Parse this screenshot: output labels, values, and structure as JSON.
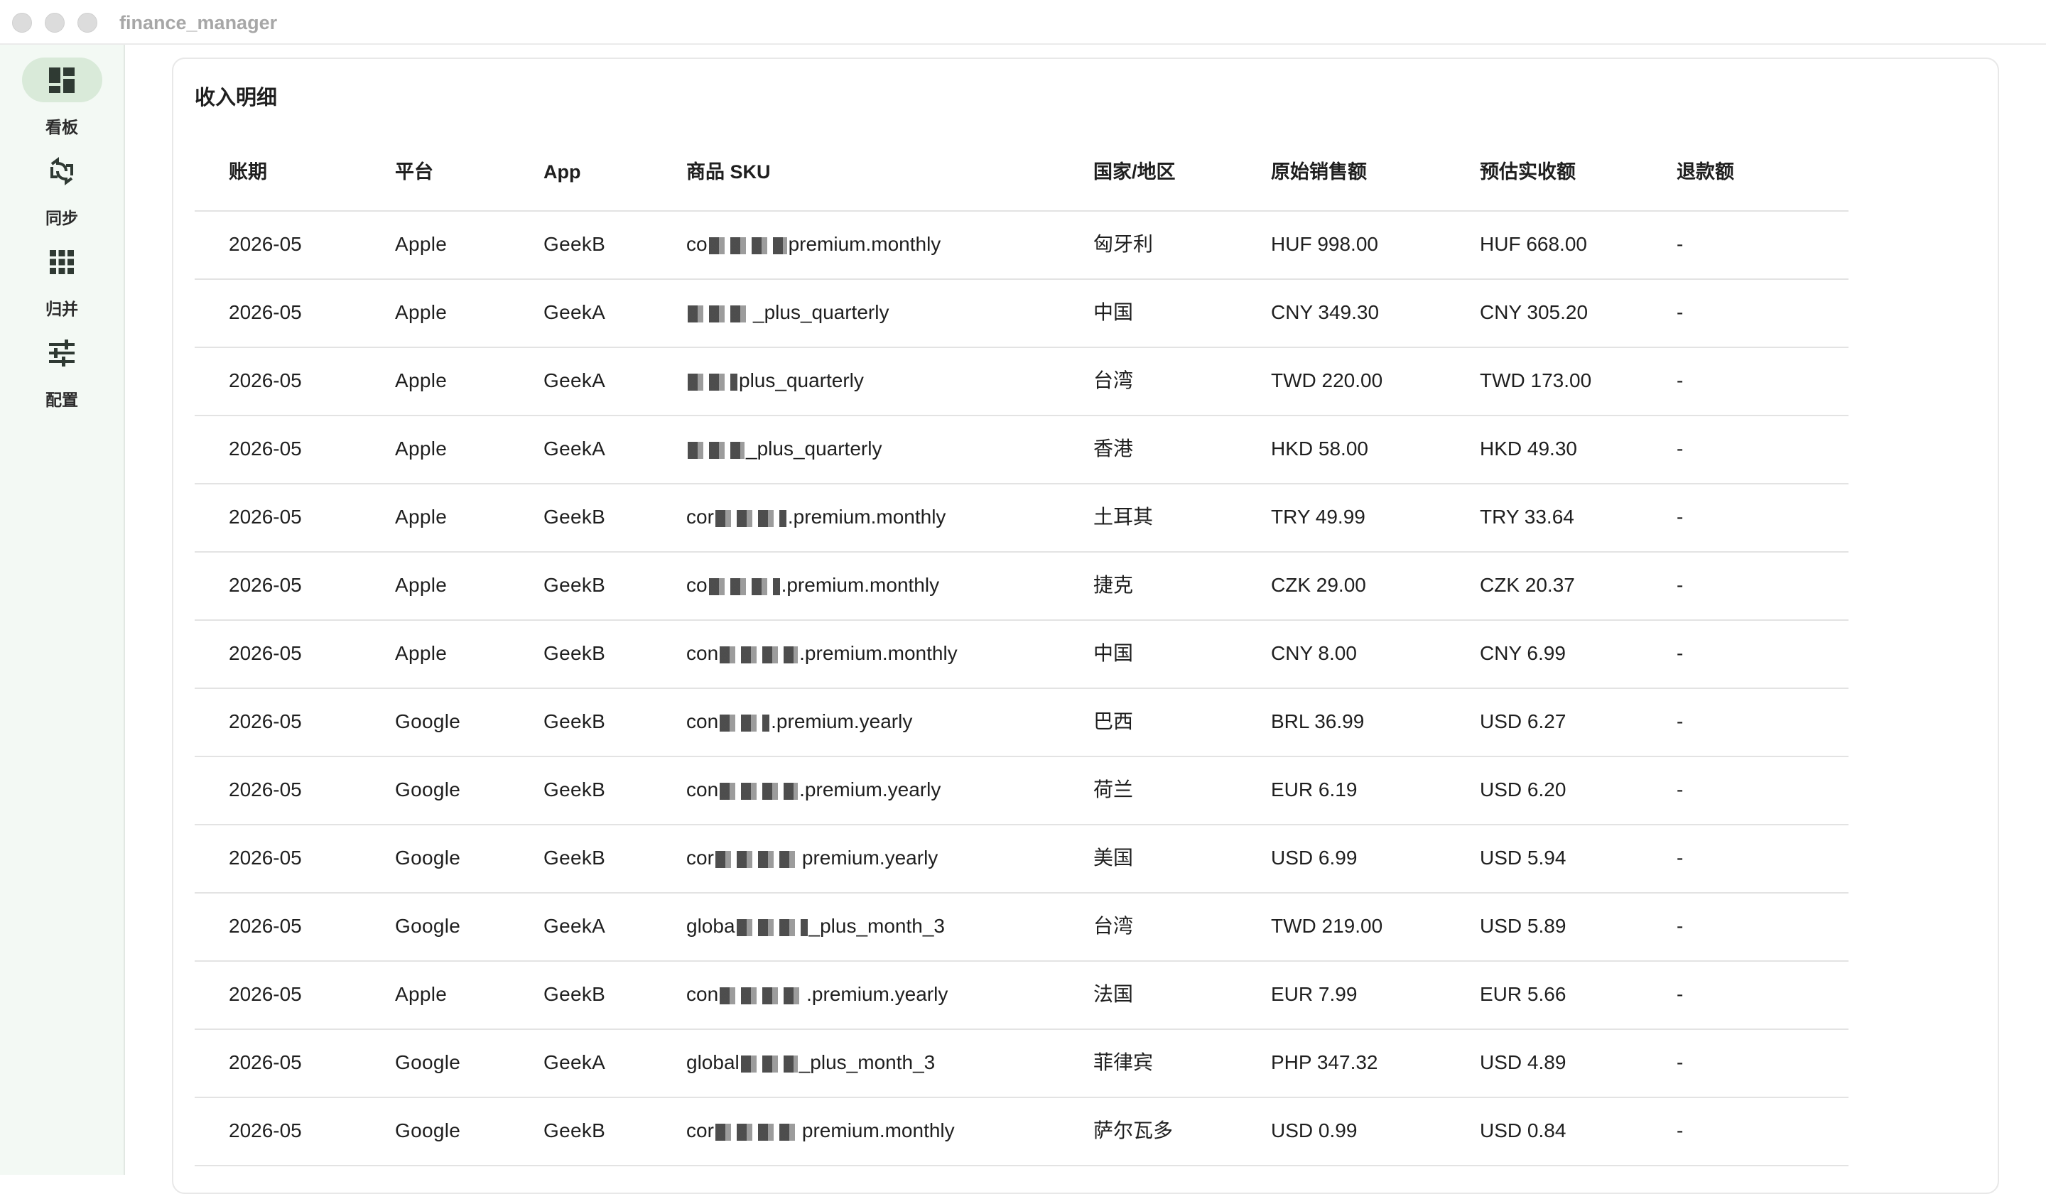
{
  "window": {
    "title": "finance_manager"
  },
  "sidebar": {
    "items": [
      {
        "label": "看板",
        "icon": "dashboard-icon",
        "active": true
      },
      {
        "label": "同步",
        "icon": "sync-icon",
        "active": false
      },
      {
        "label": "归并",
        "icon": "grid-icon",
        "active": false
      },
      {
        "label": "配置",
        "icon": "sliders-icon",
        "active": false
      }
    ]
  },
  "main": {
    "card_title": "收入明细",
    "table": {
      "columns": [
        "账期",
        "平台",
        "App",
        "商品 SKU",
        "国家/地区",
        "原始销售额",
        "预估实收额",
        "退款额"
      ],
      "rows": [
        {
          "period": "2026-05",
          "platform": "Apple",
          "app": "GeekB",
          "sku_prefix": "co",
          "sku_suffix": "premium.monthly",
          "region": "匈牙利",
          "gross": "HUF 998.00",
          "net": "HUF 668.00",
          "refund": "-"
        },
        {
          "period": "2026-05",
          "platform": "Apple",
          "app": "GeekA",
          "sku_prefix": "",
          "sku_suffix": "_plus_quarterly",
          "region": "中国",
          "gross": "CNY 349.30",
          "net": "CNY 305.20",
          "refund": "-"
        },
        {
          "period": "2026-05",
          "platform": "Apple",
          "app": "GeekA",
          "sku_prefix": "",
          "sku_suffix": "plus_quarterly",
          "region": "台湾",
          "gross": "TWD 220.00",
          "net": "TWD 173.00",
          "refund": "-"
        },
        {
          "period": "2026-05",
          "platform": "Apple",
          "app": "GeekA",
          "sku_prefix": "",
          "sku_suffix": "_plus_quarterly",
          "region": "香港",
          "gross": "HKD 58.00",
          "net": "HKD 49.30",
          "refund": "-"
        },
        {
          "period": "2026-05",
          "platform": "Apple",
          "app": "GeekB",
          "sku_prefix": "cor",
          "sku_suffix": ".premium.monthly",
          "region": "土耳其",
          "gross": "TRY 49.99",
          "net": "TRY 33.64",
          "refund": "-"
        },
        {
          "period": "2026-05",
          "platform": "Apple",
          "app": "GeekB",
          "sku_prefix": "co",
          "sku_suffix": ".premium.monthly",
          "region": "捷克",
          "gross": "CZK 29.00",
          "net": "CZK 20.37",
          "refund": "-"
        },
        {
          "period": "2026-05",
          "platform": "Apple",
          "app": "GeekB",
          "sku_prefix": "con",
          "sku_suffix": ".premium.monthly",
          "region": "中国",
          "gross": "CNY 8.00",
          "net": "CNY 6.99",
          "refund": "-"
        },
        {
          "period": "2026-05",
          "platform": "Google",
          "app": "GeekB",
          "sku_prefix": "con",
          "sku_suffix": ".premium.yearly",
          "region": "巴西",
          "gross": "BRL 36.99",
          "net": "USD 6.27",
          "refund": "-"
        },
        {
          "period": "2026-05",
          "platform": "Google",
          "app": "GeekB",
          "sku_prefix": "con",
          "sku_suffix": ".premium.yearly",
          "region": "荷兰",
          "gross": "EUR 6.19",
          "net": "USD 6.20",
          "refund": "-"
        },
        {
          "period": "2026-05",
          "platform": "Google",
          "app": "GeekB",
          "sku_prefix": "cor",
          "sku_suffix": "premium.yearly",
          "region": "美国",
          "gross": "USD 6.99",
          "net": "USD 5.94",
          "refund": "-"
        },
        {
          "period": "2026-05",
          "platform": "Google",
          "app": "GeekA",
          "sku_prefix": "globa",
          "sku_suffix": "_plus_month_3",
          "region": "台湾",
          "gross": "TWD 219.00",
          "net": "USD 5.89",
          "refund": "-"
        },
        {
          "period": "2026-05",
          "platform": "Apple",
          "app": "GeekB",
          "sku_prefix": "con",
          "sku_suffix": ".premium.yearly",
          "region": "法国",
          "gross": "EUR 7.99",
          "net": "EUR 5.66",
          "refund": "-"
        },
        {
          "period": "2026-05",
          "platform": "Google",
          "app": "GeekA",
          "sku_prefix": "global",
          "sku_suffix": "_plus_month_3",
          "region": "菲律宾",
          "gross": "PHP 347.32",
          "net": "USD 4.89",
          "refund": "-"
        },
        {
          "period": "2026-05",
          "platform": "Google",
          "app": "GeekB",
          "sku_prefix": "cor",
          "sku_suffix": "premium.monthly",
          "region": "萨尔瓦多",
          "gross": "USD 0.99",
          "net": "USD 0.84",
          "refund": "-"
        }
      ]
    }
  },
  "colors": {
    "sidebar_bg": "#f3f9f4",
    "active_pill": "#d9ead9",
    "divider": "#e3e3e3"
  }
}
